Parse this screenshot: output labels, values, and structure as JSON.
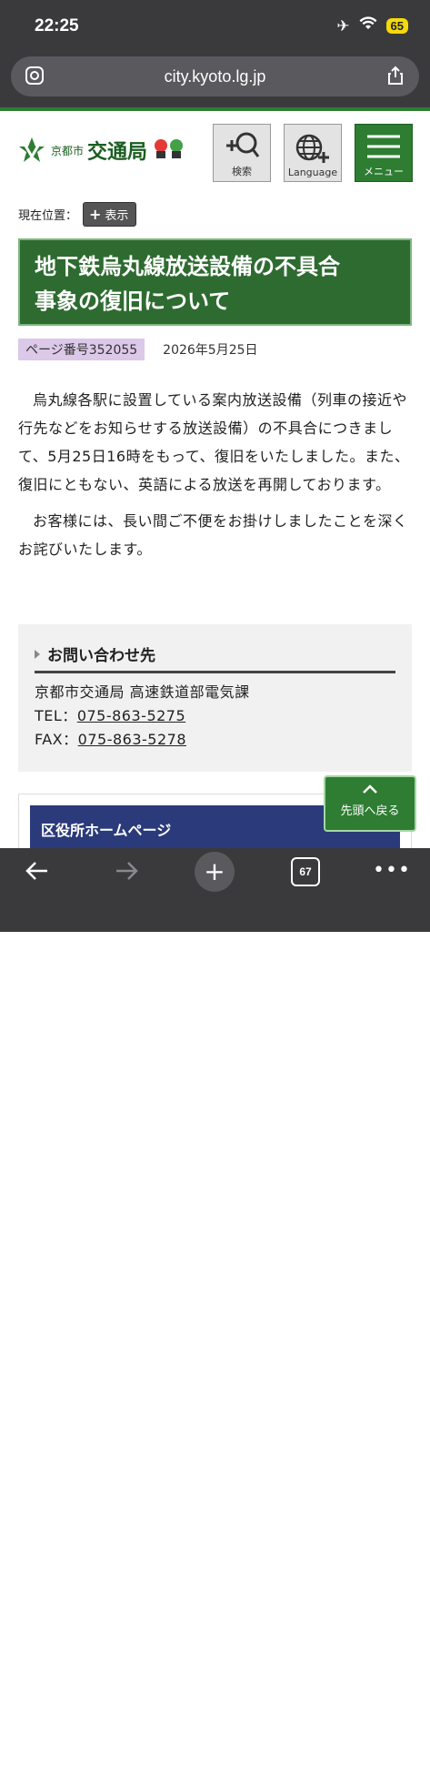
{
  "status": {
    "time": "22:25",
    "battery": "65"
  },
  "browser": {
    "url": "city.kyoto.lg.jp",
    "tab_count": "67"
  },
  "header": {
    "logo_city": "京都市",
    "logo_name": "交通局",
    "search_label": "検索",
    "language_label": "Language",
    "menu_label": "メニュー"
  },
  "breadcrumb": {
    "label": "現在位置：",
    "button": "表示"
  },
  "article": {
    "title_line1": "地下鉄烏丸線放送設備の不具合",
    "title_line2": "事象の復旧について",
    "page_number": "ページ番号352055",
    "date": "2026年5月25日",
    "paragraph1": "烏丸線各駅に設置している案内放送設備（列車の接近や行先などをお知らせする放送設備）の不具合につきまして、5月25日16時をもって、復旧をいたしました。また、復旧にともない、英語による放送を再開しております。",
    "paragraph2": "お客様には、長い間ご不便をお掛けしましたことを深くお詫びいたします。"
  },
  "contact": {
    "heading": "お問い合わせ先",
    "org": "京都市交通局 高速鉄道部電気課",
    "tel_label": "TEL：",
    "tel": "075-863-5275",
    "fax_label": "FAX：",
    "fax": "075-863-5278"
  },
  "ward_banner": "区役所ホームページ",
  "back_to_top": "先頭へ戻る",
  "colors": {
    "brand_green": "#2e6b30",
    "ward_blue": "#2a3a7a",
    "page_no_bg": "#dcc8e8"
  }
}
